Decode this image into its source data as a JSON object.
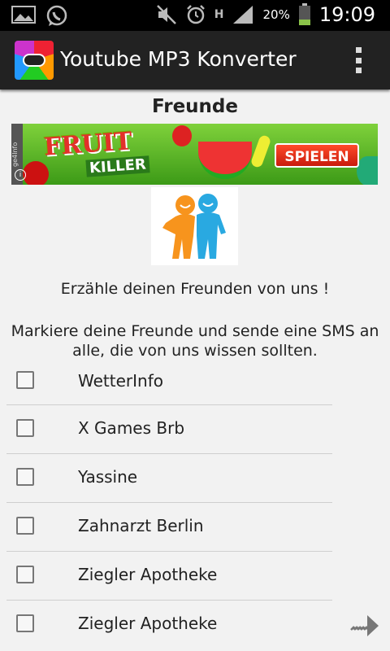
{
  "status_bar": {
    "battery_percent": "20%",
    "network_type": "H",
    "time": "19:09",
    "icons": [
      "gallery-icon",
      "whatsapp-icon",
      "mute-icon",
      "alarm-icon",
      "signal-icon",
      "battery-icon"
    ]
  },
  "app": {
    "title": "Youtube MP3 Konverter",
    "colors": {
      "action_bar": "#222222",
      "background": "#f2f2f2"
    }
  },
  "page": {
    "title": "Freunde",
    "intro": "Erzähle deinen Freunden von uns !",
    "instructions": "Markiere deine Freunde und sende eine SMS an alle, die von uns wissen sollten."
  },
  "ad": {
    "game_title_1": "FRUIT",
    "game_title_2": "KILLER",
    "button": "SPIELEN",
    "side_text": "ge4Info"
  },
  "contacts": [
    {
      "name": "WetterInfo",
      "checked": false
    },
    {
      "name": "X Games Brb",
      "checked": false
    },
    {
      "name": "Yassine",
      "checked": false
    },
    {
      "name": "Zahnarzt Berlin",
      "checked": false
    },
    {
      "name": "Ziegler Apotheke",
      "checked": false
    },
    {
      "name": "Ziegler Apotheke",
      "checked": false
    }
  ]
}
